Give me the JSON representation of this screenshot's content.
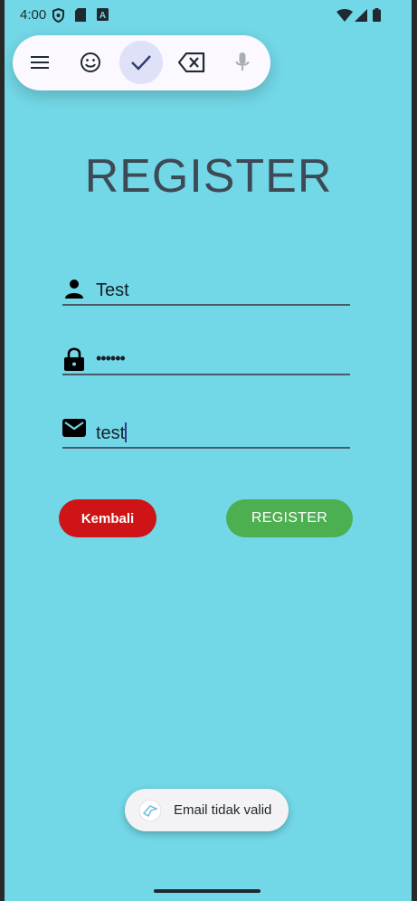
{
  "status_bar": {
    "time": "4:00",
    "icons": [
      "shield-icon",
      "sd-card-icon",
      "a-box-icon",
      "wifi-icon",
      "signal-icon",
      "battery-icon"
    ]
  },
  "keyboard_toolbar": {
    "buttons": [
      "menu-icon",
      "emoji-icon",
      "check-icon",
      "backspace-icon",
      "mic-icon"
    ]
  },
  "title": "REGISTER",
  "form": {
    "username": {
      "icon": "person-icon",
      "value": "Test"
    },
    "password": {
      "icon": "lock-icon",
      "value": "••••••"
    },
    "email": {
      "icon": "mail-icon",
      "value": "test"
    }
  },
  "buttons": {
    "back_label": "Kembali",
    "register_label": "REGISTER"
  },
  "toast": {
    "icon": "app-icon",
    "text": "Email tidak valid"
  },
  "colors": {
    "background": "#72d7e6",
    "title": "#3d4a55",
    "back_button": "#cf1418",
    "register_button": "#4caf50"
  }
}
